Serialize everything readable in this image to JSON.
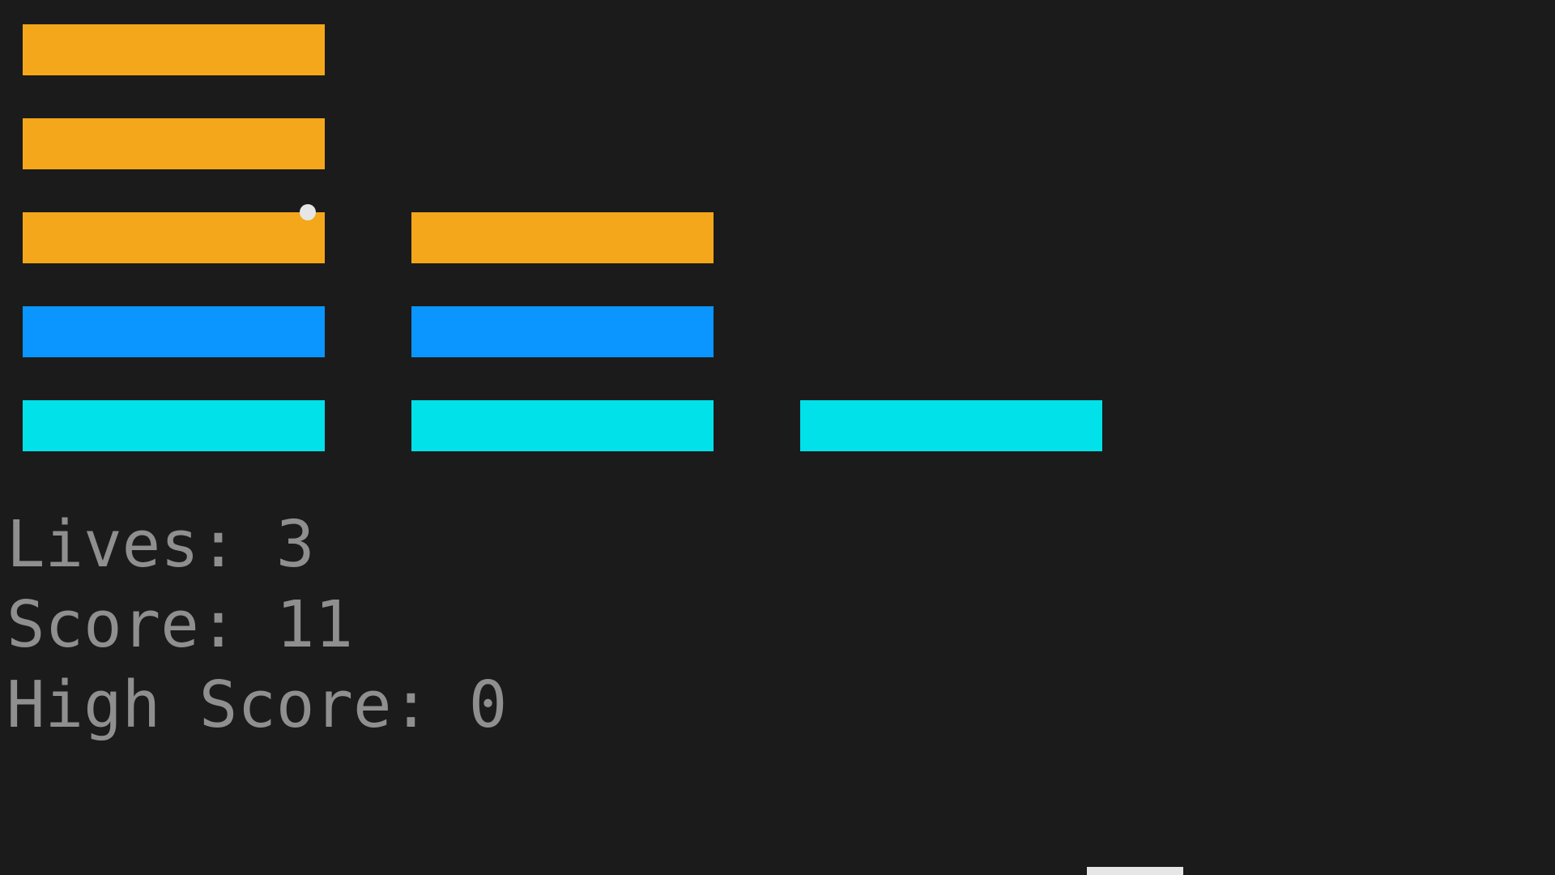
{
  "colors": {
    "background": "#1b1b1b",
    "orange": "#f4a71a",
    "blue": "#0a95ff",
    "cyan": "#00e1ea",
    "hud_text": "#8f8f8f",
    "ball": "#e6e6e6",
    "paddle": "#e6e6e6"
  },
  "bricks": [
    {
      "row": 0,
      "col": 0,
      "color": "orange"
    },
    {
      "row": 1,
      "col": 0,
      "color": "orange"
    },
    {
      "row": 2,
      "col": 0,
      "color": "orange"
    },
    {
      "row": 2,
      "col": 1,
      "color": "orange"
    },
    {
      "row": 3,
      "col": 0,
      "color": "blue"
    },
    {
      "row": 3,
      "col": 1,
      "color": "blue"
    },
    {
      "row": 4,
      "col": 0,
      "color": "cyan"
    },
    {
      "row": 4,
      "col": 1,
      "color": "cyan"
    },
    {
      "row": 4,
      "col": 2,
      "color": "cyan"
    }
  ],
  "hud": {
    "lives": "Lives: 3",
    "score": "Score: 11",
    "high_score": "High Score: 0"
  }
}
